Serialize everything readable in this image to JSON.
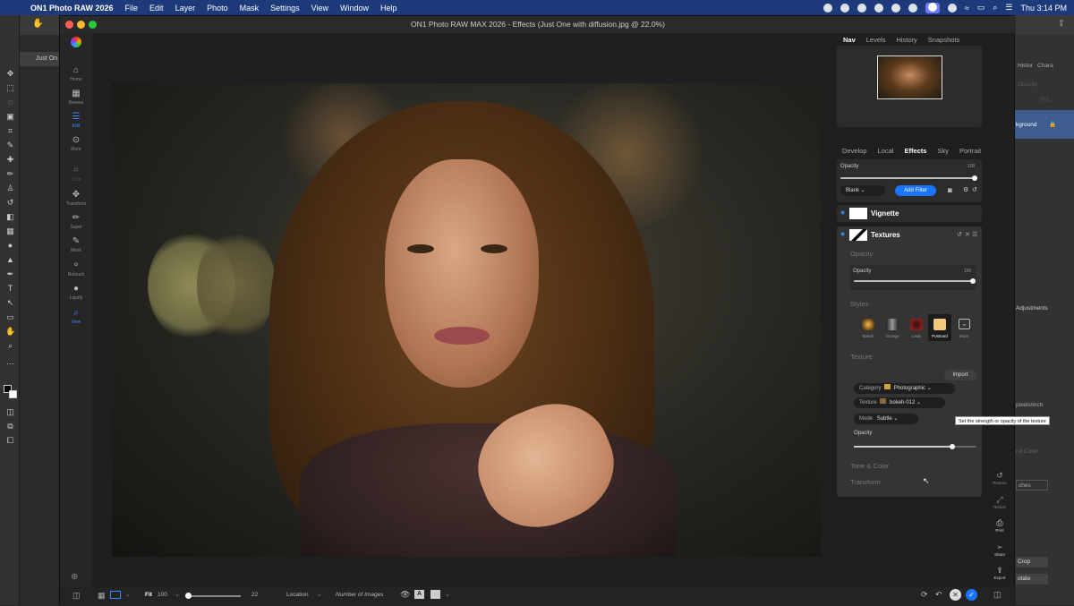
{
  "menubar": {
    "app_name": "ON1 Photo RAW 2026",
    "menus": [
      "File",
      "Edit",
      "Layer",
      "Photo",
      "Mask",
      "Settings",
      "View",
      "Window",
      "Help"
    ],
    "clock": "Thu 3:14 PM"
  },
  "ps_backdrop": {
    "doc_tab": "Just On",
    "right_items": [
      "Histor",
      "Chara",
      "Opacity:",
      "Fill:",
      "kground",
      "Adjustments",
      "pixels/inch",
      "nd Color",
      "ches",
      "Crop",
      "otate"
    ]
  },
  "window": {
    "title": "ON1 Photo RAW MAX 2026 - Effects (Just One with diffusion.jpg @ 22.0%)"
  },
  "leftnav": {
    "items": [
      {
        "label": "Home",
        "icon": "home-icon"
      },
      {
        "label": "Browse",
        "icon": "grid-icon"
      },
      {
        "label": "Edit",
        "icon": "sliders-icon",
        "active": true
      },
      {
        "label": "More",
        "icon": "more-icon"
      },
      {
        "label": "Crop",
        "icon": "crop-icon"
      },
      {
        "label": "Transform",
        "icon": "move-icon"
      },
      {
        "label": "Super",
        "icon": "brush-icon"
      },
      {
        "label": "Mask",
        "icon": "mask-brush-icon"
      },
      {
        "label": "Retouch",
        "icon": "retouch-icon"
      },
      {
        "label": "Liquify",
        "icon": "liquify-icon"
      },
      {
        "label": "View",
        "icon": "zoom-icon",
        "active": true
      }
    ]
  },
  "top_tabs": [
    "Nav",
    "Levels",
    "History",
    "Snapshots"
  ],
  "module_tabs": [
    "Develop",
    "Local",
    "Effects",
    "Sky",
    "Portrait"
  ],
  "effects": {
    "opacity_label": "Opacity",
    "opacity_value": "100",
    "opacity_level": 1.0,
    "blank_label": "Blank",
    "add_filter_label": "Add Filter",
    "filters": [
      {
        "name": "Vignette"
      },
      {
        "name": "Textures"
      }
    ],
    "textures": {
      "section_opacity": "Opacity",
      "inner_opacity_label": "Opacity",
      "inner_opacity_value": "100",
      "inner_opacity_level": 1.0,
      "styles_header": "Styles",
      "styles": [
        "Bokeh",
        "Grunge",
        "Leak",
        "Postcard",
        "More"
      ],
      "texture_header": "Texture",
      "import_label": "Import",
      "category_label": "Category",
      "category_value": "Photographic",
      "texture_label": "Texture",
      "texture_value": "bokeh-012",
      "mode_label": "Mode",
      "mode_value": "Subtle",
      "texture_opacity_label": "Opacity",
      "texture_opacity_level": 0.8,
      "tone_color": "Tone & Color",
      "transform": "Transform"
    },
    "tooltip": "Set the strength or opacity of the texture"
  },
  "side_tools": [
    "Restore",
    "Resize",
    "Print",
    "Share",
    "Export"
  ],
  "bottombar": {
    "fit_label": "Fit",
    "zoom_value": "100",
    "size_value": "22",
    "location_label": "Location",
    "number_of_images": "Number of Images"
  },
  "colors": {
    "accent": "#1a74ff",
    "menubar": "#1d3b7a"
  }
}
